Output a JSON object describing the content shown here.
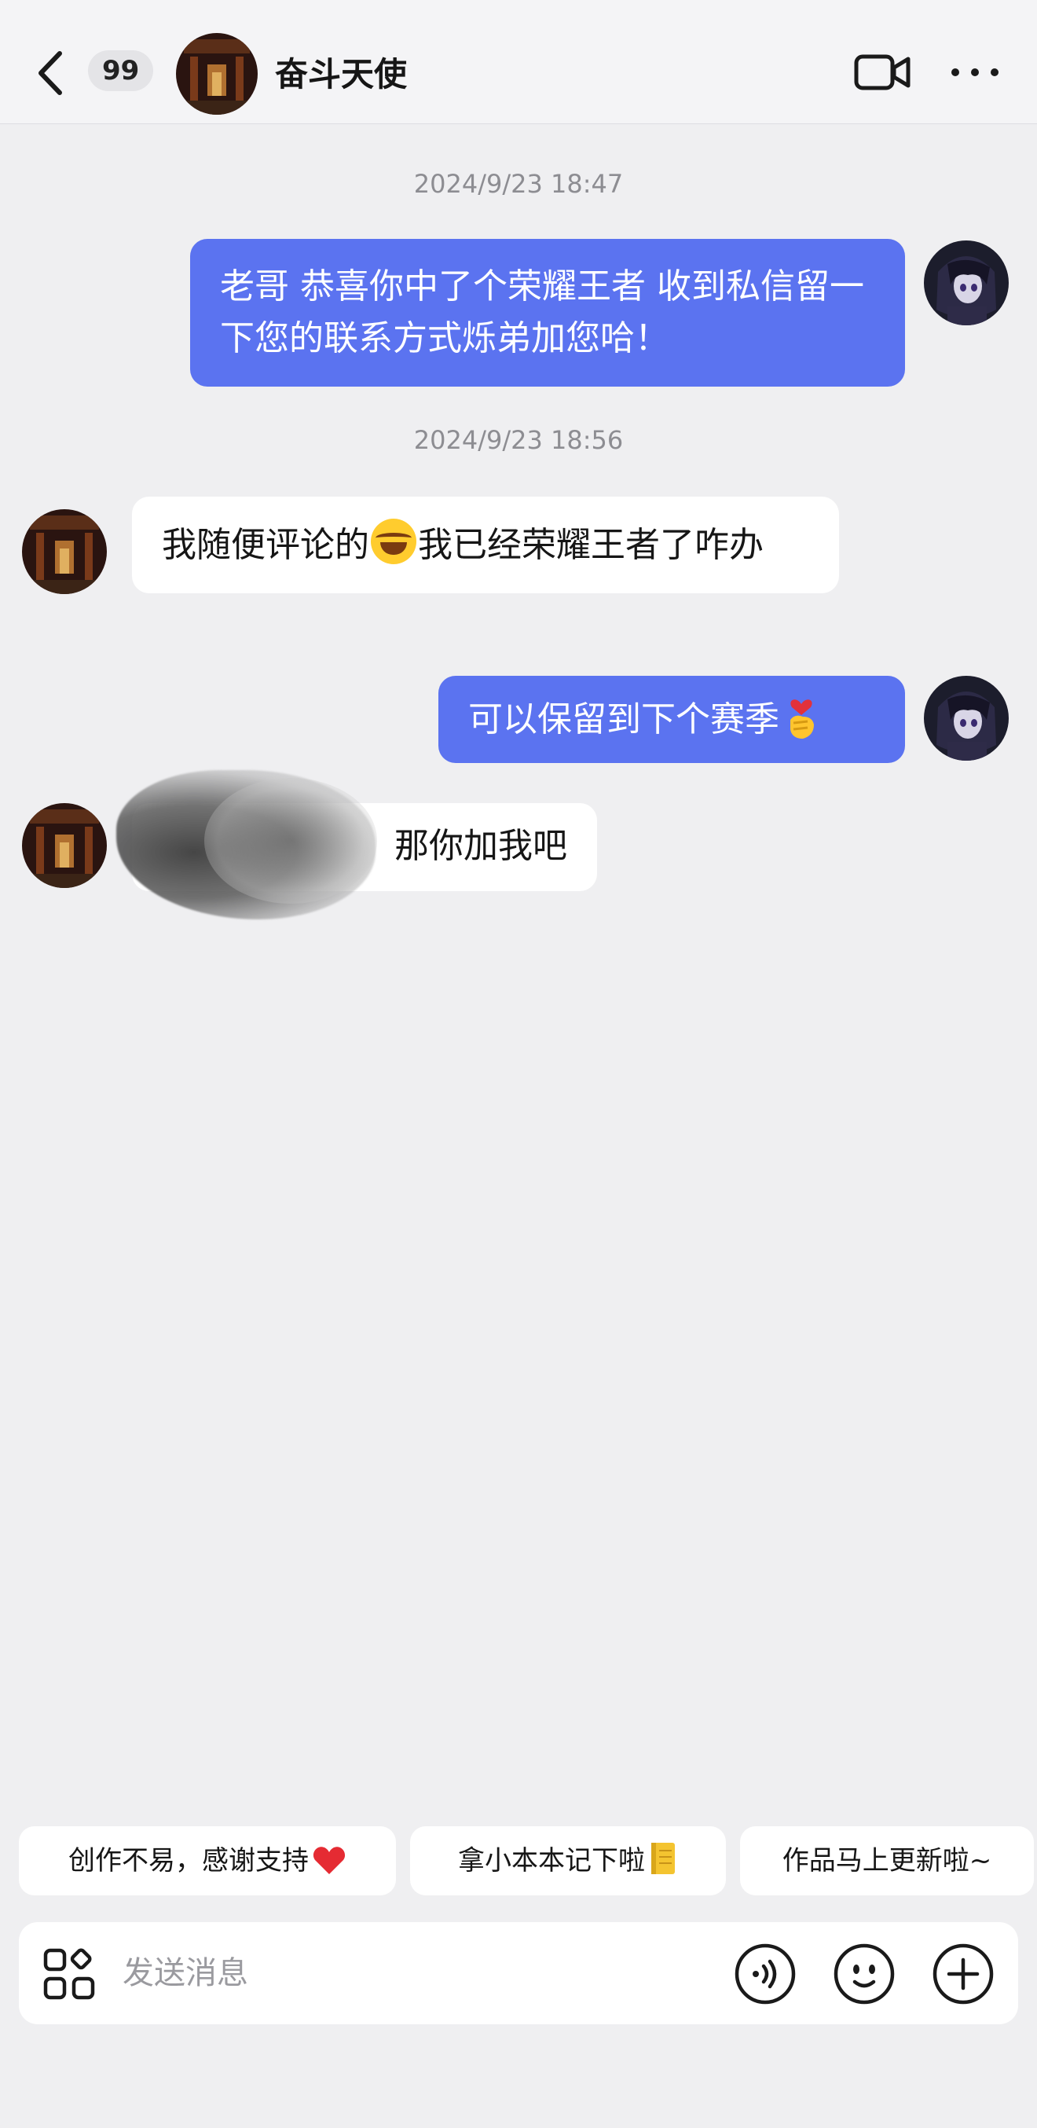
{
  "header": {
    "unread_count": "99",
    "contact_name": "奋斗天使"
  },
  "messages": [
    {
      "type": "timestamp",
      "text": "2024/9/23 18:47"
    },
    {
      "type": "outgoing",
      "text": "老哥 恭喜你中了个荣耀王者 收到私信留一下您的联系方式烁弟加您哈！"
    },
    {
      "type": "timestamp",
      "text": "2024/9/23 18:56"
    },
    {
      "type": "incoming",
      "text_before": "我随便评论的",
      "emoji": "tears-of-joy-emoji",
      "text_after": "我已经荣耀王者了咋办"
    },
    {
      "type": "outgoing",
      "text": "可以保留到下个赛季",
      "emoji": "finger-heart-emoji"
    },
    {
      "type": "incoming",
      "text": "那你加我吧",
      "redacted": true
    }
  ],
  "quick_replies": [
    {
      "label": "创作不易，感谢支持",
      "emoji": "red-heart-emoji"
    },
    {
      "label": "拿小本本记下啦",
      "emoji": "notebook-emoji"
    },
    {
      "label": "作品马上更新啦~"
    }
  ],
  "composer": {
    "placeholder": "发送消息"
  },
  "icons": [
    "back-icon",
    "video-call-icon",
    "more-icon",
    "apps-icon",
    "voice-icon",
    "emoji-icon",
    "add-icon"
  ],
  "colors": {
    "outgoing_bubble": "#5b73f0",
    "incoming_bubble": "#ffffff",
    "background": "#efeff1"
  }
}
